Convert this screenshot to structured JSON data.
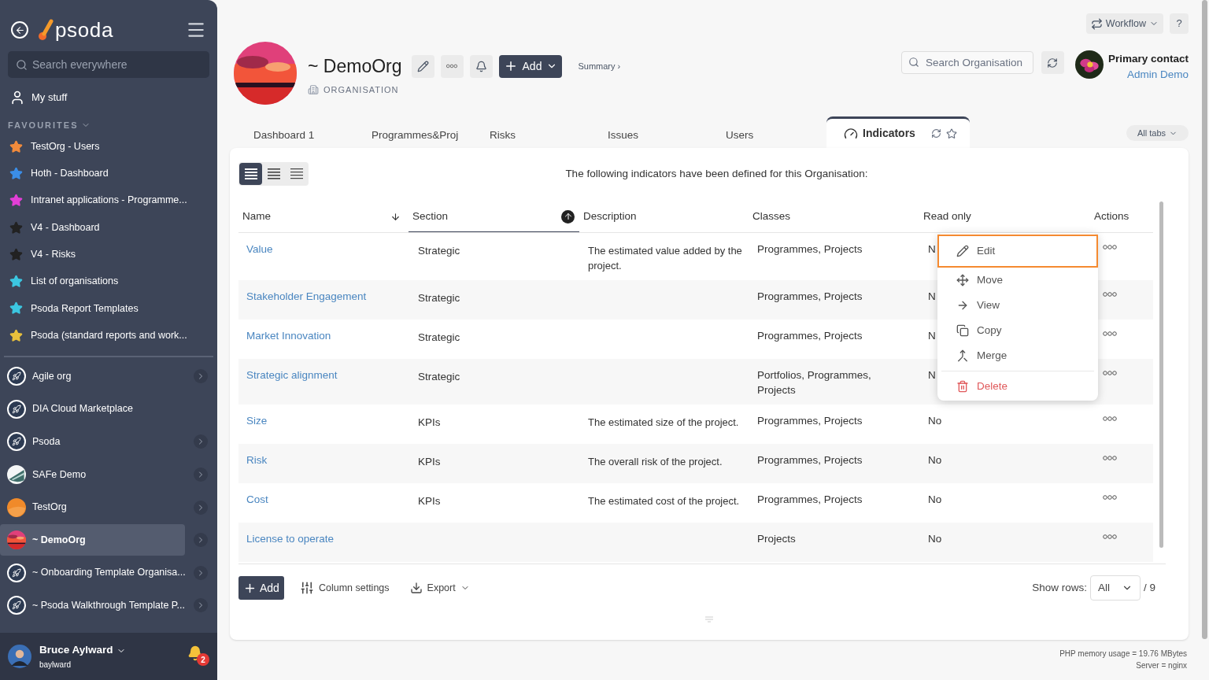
{
  "sidebar": {
    "logo": "psoda",
    "search": {
      "placeholder": "Search everywhere"
    },
    "my_stuff": "My stuff",
    "favourites_heading": "FAVOURITES",
    "favourites": [
      {
        "label": "TestOrg - Users",
        "color": "#f28b3c"
      },
      {
        "label": "Hoth - Dashboard",
        "color": "#3b8ee8"
      },
      {
        "label": "Intranet applications - Programme...",
        "color": "#e23fd6"
      },
      {
        "label": "V4 - Dashboard",
        "color": "#222222"
      },
      {
        "label": "V4 - Risks",
        "color": "#222222"
      },
      {
        "label": "List of organisations",
        "color": "#3cc6e0"
      },
      {
        "label": "Psoda Report Templates",
        "color": "#3cc6e0"
      },
      {
        "label": "Psoda (standard reports and work...",
        "color": "#e8c03c"
      }
    ],
    "organisations": [
      {
        "label": "Agile org",
        "kind": "rocket",
        "selected": false,
        "expandable": true
      },
      {
        "label": "DIA Cloud Marketplace",
        "kind": "rocket",
        "selected": false,
        "expandable": false
      },
      {
        "label": "Psoda",
        "kind": "rocket",
        "selected": false,
        "expandable": true
      },
      {
        "label": "SAFe Demo",
        "kind": "picture",
        "selected": false,
        "expandable": true
      },
      {
        "label": "TestOrg",
        "kind": "orange",
        "selected": false,
        "expandable": true
      },
      {
        "label": "~ DemoOrg",
        "kind": "sunset",
        "selected": true,
        "expandable": true
      },
      {
        "label": "~ Onboarding Template Organisa...",
        "kind": "rocket",
        "selected": false,
        "expandable": true
      },
      {
        "label": "~ Psoda Walkthrough Template P...",
        "kind": "rocket",
        "selected": false,
        "expandable": true
      }
    ],
    "user": {
      "name": "Bruce Aylward",
      "username": "baylward",
      "notifications": "2"
    }
  },
  "header": {
    "workflow": "Workflow",
    "help": "?",
    "title": "~ DemoOrg",
    "type": "ORGANISATION",
    "add": "Add",
    "summary": "Summary ›",
    "search": {
      "placeholder": "Search Organisation"
    },
    "contact_label": "Primary contact",
    "contact_name": "Admin Demo"
  },
  "tabs": [
    {
      "label": "Dashboard 1",
      "selected": false
    },
    {
      "label": "Programmes&Proj",
      "selected": false
    },
    {
      "label": "Risks",
      "selected": false
    },
    {
      "label": "Issues",
      "selected": false
    },
    {
      "label": "Users",
      "selected": false
    },
    {
      "label": "Indicators",
      "selected": true
    }
  ],
  "all_tabs": "All tabs",
  "view_modes": [
    {
      "selected": true
    },
    {
      "selected": false
    },
    {
      "selected": false
    }
  ],
  "intro": "The following indicators have been defined for this Organisation:",
  "table": {
    "columns": [
      "Name",
      "Section",
      "Description",
      "Classes",
      "Read only",
      "Actions"
    ],
    "rows": [
      {
        "name": "Value",
        "section": "Strategic",
        "description": "The estimated value added by the project.",
        "classes": "Programmes, Projects",
        "read_only": "N"
      },
      {
        "name": "Stakeholder Engagement",
        "section": "Strategic",
        "description": "",
        "classes": "Programmes, Projects",
        "read_only": "N"
      },
      {
        "name": "Market Innovation",
        "section": "Strategic",
        "description": "",
        "classes": "Programmes, Projects",
        "read_only": "N"
      },
      {
        "name": "Strategic alignment",
        "section": "Strategic",
        "description": "",
        "classes": "Portfolios, Programmes, Projects",
        "read_only": "N"
      },
      {
        "name": "Size",
        "section": "KPIs",
        "description": "The estimated size of the project.",
        "classes": "Programmes, Projects",
        "read_only": "No"
      },
      {
        "name": "Risk",
        "section": "KPIs",
        "description": "The overall risk of the project.",
        "classes": "Programmes, Projects",
        "read_only": "No"
      },
      {
        "name": "Cost",
        "section": "KPIs",
        "description": "The estimated cost of the project.",
        "classes": "Programmes, Projects",
        "read_only": "No"
      },
      {
        "name": "License to operate",
        "section": "",
        "description": "",
        "classes": "Projects",
        "read_only": "No"
      }
    ]
  },
  "menu": [
    {
      "label": "Edit",
      "kind": "edit",
      "selected": true
    },
    {
      "label": "Move",
      "kind": "move",
      "selected": false
    },
    {
      "label": "View",
      "kind": "view",
      "selected": false
    },
    {
      "label": "Copy",
      "kind": "copy",
      "selected": false
    },
    {
      "label": "Merge",
      "kind": "merge",
      "selected": false
    },
    {
      "label": "Delete",
      "kind": "delete",
      "selected": false
    }
  ],
  "footer": {
    "add": "Add",
    "column_settings": "Column settings",
    "export": "Export",
    "show_rows_label": "Show rows:",
    "show_rows_value": "All",
    "total": "/ 9"
  },
  "server_info": [
    "PHP memory usage = 19.76 MBytes",
    "Server = nginx"
  ]
}
